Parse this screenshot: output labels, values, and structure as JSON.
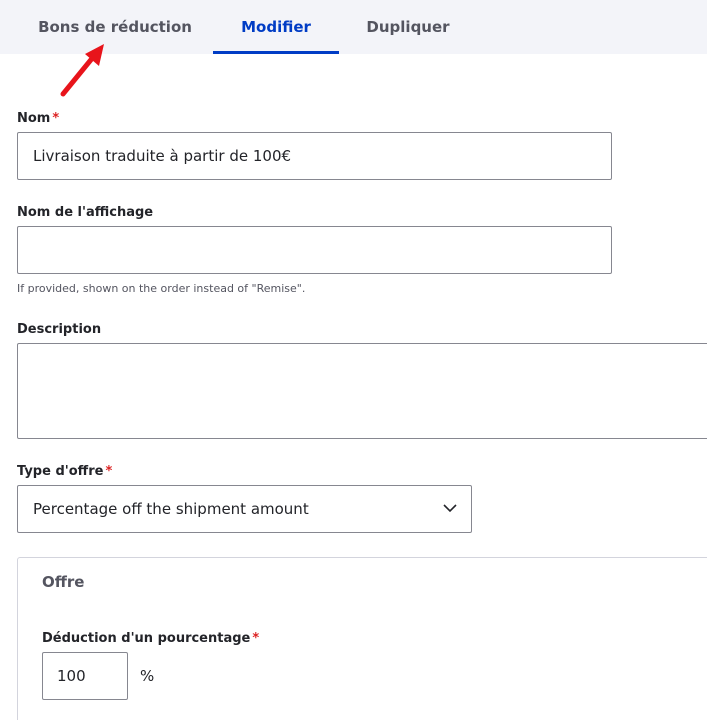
{
  "tabs": [
    {
      "label": "Bons de réduction",
      "active": false
    },
    {
      "label": "Modifier",
      "active": true
    },
    {
      "label": "Dupliquer",
      "active": false
    }
  ],
  "form": {
    "name": {
      "label": "Nom",
      "required_marker": "*",
      "value": "Livraison traduite à partir de 100€"
    },
    "display_name": {
      "label": "Nom de l'affichage",
      "value": "",
      "help": "If provided, shown on the order instead of \"Remise\"."
    },
    "description": {
      "label": "Description",
      "value": ""
    },
    "offer_type": {
      "label": "Type d'offre",
      "required_marker": "*",
      "selected": "Percentage off the shipment amount"
    },
    "offer": {
      "legend": "Offre",
      "percentage": {
        "label": "Déduction d'un pourcentage",
        "required_marker": "*",
        "value": "100",
        "suffix": "%"
      }
    }
  },
  "colors": {
    "accent": "#003cc5",
    "required": "#dc2323",
    "annotation_arrow": "#e8141b"
  },
  "icons": {
    "annotation": "red-arrow-icon",
    "select": "chevron-down-icon"
  }
}
